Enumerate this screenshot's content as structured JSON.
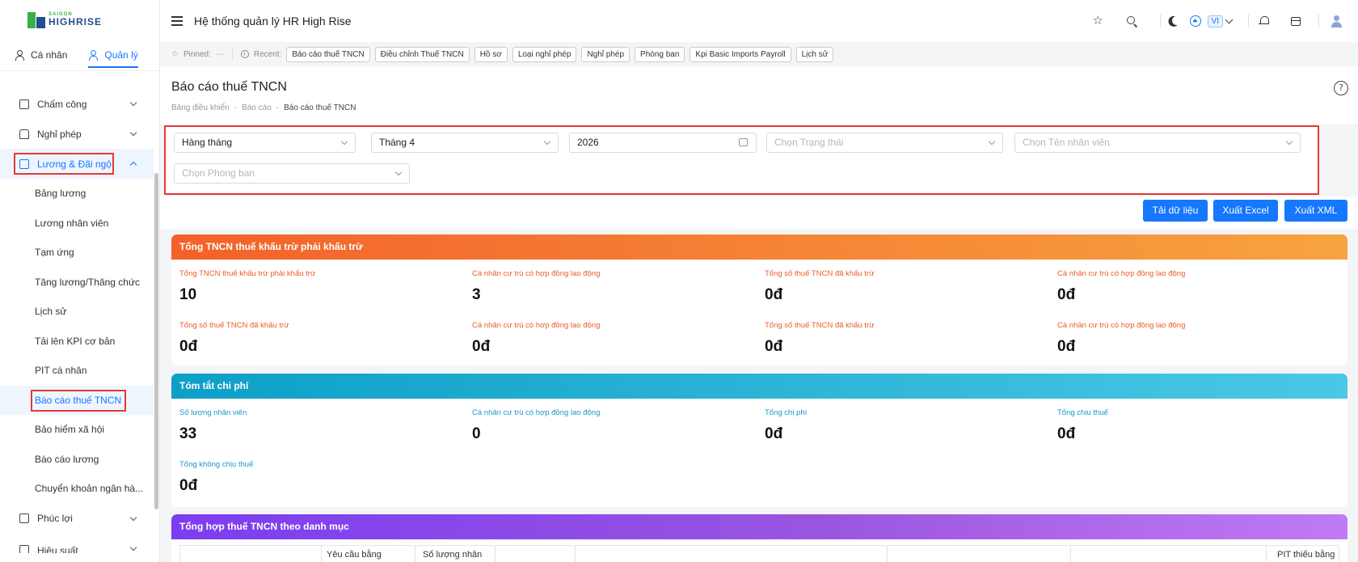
{
  "logo": {
    "line1": "SAIGON",
    "line2": "HIGHRISE"
  },
  "sidebar": {
    "tabs": [
      {
        "label": "Cá nhân"
      },
      {
        "label": "Quản lý"
      }
    ],
    "menu": [
      {
        "label": "Chấm công"
      },
      {
        "label": "Nghỉ phép"
      },
      {
        "label": "Lương & Đãi ngộ"
      }
    ],
    "submenu": [
      {
        "label": "Bảng lương"
      },
      {
        "label": "Lương nhân viên"
      },
      {
        "label": "Tạm ứng"
      },
      {
        "label": "Tăng lương/Thăng chức"
      },
      {
        "label": "Lịch sử"
      },
      {
        "label": "Tải lên KPI cơ bản"
      },
      {
        "label": "PIT cá nhân"
      },
      {
        "label": "Báo cáo thuế TNCN"
      },
      {
        "label": "Bảo hiểm xã hội"
      },
      {
        "label": "Báo cáo lương"
      },
      {
        "label": "Chuyển khoản ngân hà..."
      }
    ],
    "bottom": [
      {
        "label": "Phúc lợi"
      },
      {
        "label": "Hiệu suất"
      }
    ]
  },
  "header": {
    "title": "Hệ thống quản lý HR High Rise",
    "lang": "VI"
  },
  "pinbar": {
    "pinned_label": "Pinned:",
    "pinned_value": "---",
    "recent_label": "Recent:",
    "chips": [
      "Báo cáo thuế TNCN",
      "Điều chỉnh Thuế TNCN",
      "Hồ sơ",
      "Loại nghỉ phép",
      "Nghỉ phép",
      "Phòng ban",
      "Kpi Basic Imports Payroll",
      "Lịch sử"
    ]
  },
  "page": {
    "title": "Báo cáo thuế TNCN",
    "breadcrumb": [
      "Bảng điều khiển",
      "Báo cáo",
      "Báo cáo thuế TNCN"
    ],
    "help": "?"
  },
  "filters": {
    "period": "Hàng tháng",
    "month": "Tháng 4",
    "year": "2026",
    "status_placeholder": "Chọn Trạng thái",
    "employee_placeholder": "Chọn Tên nhân viên",
    "department_placeholder": "Chọn Phòng ban"
  },
  "actions": {
    "reload": "Tải dữ liệu",
    "excel": "Xuất Excel",
    "xml": "Xuất XML"
  },
  "card1": {
    "title": "Tổng TNCN thuế khấu trừ phải khấu trừ",
    "stats": [
      {
        "label": "Tổng TNCN thuế khấu trừ phải khấu trừ",
        "value": "10"
      },
      {
        "label": "Cá nhân cư trú có hợp đồng lao động",
        "value": "3"
      },
      {
        "label": "Tổng số thuế TNCN đã khấu trừ",
        "value": "0đ"
      },
      {
        "label": "Cá nhân cư trú có hợp đồng lao động",
        "value": "0đ"
      },
      {
        "label": "Tổng số thuế TNCN đã khấu trừ",
        "value": "0đ"
      },
      {
        "label": "Cá nhân cư trú có hợp đồng lao động",
        "value": "0đ"
      },
      {
        "label": "Tổng số thuế TNCN đã khấu trừ",
        "value": "0đ"
      },
      {
        "label": "Cá nhân cư trú có hợp đồng lao động",
        "value": "0đ"
      }
    ]
  },
  "card2": {
    "title": "Tóm tắt chi phí",
    "stats": [
      {
        "label": "Số lượng nhân viên",
        "value": "33"
      },
      {
        "label": "Cá nhân cư trú có hợp đồng lao động",
        "value": "0"
      },
      {
        "label": "Tổng chi phí",
        "value": "0đ"
      },
      {
        "label": "Tổng chịu thuế",
        "value": "0đ"
      },
      {
        "label": "Tổng không chịu thuế",
        "value": "0đ"
      }
    ]
  },
  "card3": {
    "title": "Tổng hợp thuế TNCN theo danh mục",
    "headers": [
      "Yêu cầu bằng",
      "Số lượng nhân",
      "PIT thiếu bằng"
    ]
  },
  "colors": {
    "accent": "#1677ff",
    "highlight": "#e53935",
    "orange": "#f47b20",
    "teal": "#14a8d0",
    "purple": "#8a3ff0"
  }
}
